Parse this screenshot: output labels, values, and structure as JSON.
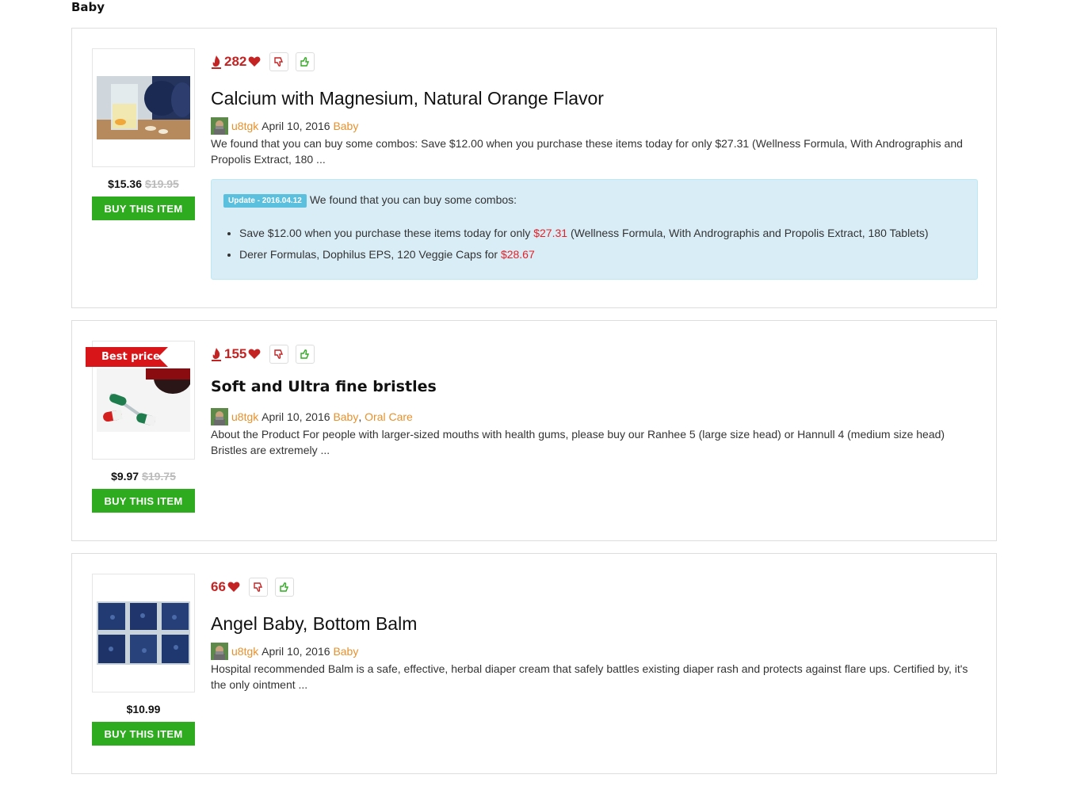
{
  "section": {
    "title": "Baby"
  },
  "products": [
    {
      "hot_count": "282",
      "title": "Calcium with Magnesium, Natural Orange Flavor",
      "author": "u8tgk",
      "date": "April 10, 2016",
      "categories": [
        "Baby"
      ],
      "excerpt": "We found that you can buy some combos: Save $12.00 when you purchase these items today for only $27.31  (Wellness Formula, With Andrographis and Propolis Extract, 180 ...",
      "price": "$15.36",
      "old_price": "$19.95",
      "buy_label": "BUY THIS ITEM",
      "update": {
        "badge": "Update - 2016.04.12",
        "intro": "We found that you can buy some combos:",
        "items": [
          {
            "pre": "Save $12.00 when you purchase these items today for only ",
            "price": "$27.31",
            "post": "  (Wellness Formula, With Andrographis and Propolis Extract, 180 Tablets)"
          },
          {
            "pre": "Derer Formulas, Dophilus EPS, 120 Veggie Caps for ",
            "price": "$28.67",
            "post": ""
          }
        ]
      }
    },
    {
      "hot_count": "155",
      "badge": "Best price",
      "title": "Soft and Ultra fine bristles",
      "author": "u8tgk",
      "date": "April 10, 2016",
      "categories": [
        "Baby",
        "Oral Care"
      ],
      "category_sep": ",",
      "excerpt": "About the Product For people with larger-sized mouths with health gums, please buy our Ranhee 5 (large size head) or Hannull 4 (medium size head) Bristles are extremely ...",
      "price": "$9.97",
      "old_price": "$19.75",
      "buy_label": "BUY THIS ITEM"
    },
    {
      "hot_count": "66",
      "title": "Angel Baby, Bottom Balm",
      "author": "u8tgk",
      "date": "April 10, 2016",
      "categories": [
        "Baby"
      ],
      "excerpt": "Hospital recommended  Balm is a safe, effective, herbal diaper cream that safely battles existing diaper rash and protects against flare ups. Certified by, it's the only ointment ...",
      "price": "$10.99",
      "buy_label": "BUY THIS ITEM"
    }
  ],
  "icons": {
    "hot": "flame-icon",
    "like": "heart-icon",
    "down": "thumbs-down-icon",
    "up": "thumbs-up-icon"
  },
  "colors": {
    "accent_red": "#c42323",
    "buy_green": "#2eab1f",
    "link_orange": "#e8912c",
    "update_bg": "#d9edf7",
    "update_badge": "#5bc0de",
    "price_red": "#e52127"
  }
}
